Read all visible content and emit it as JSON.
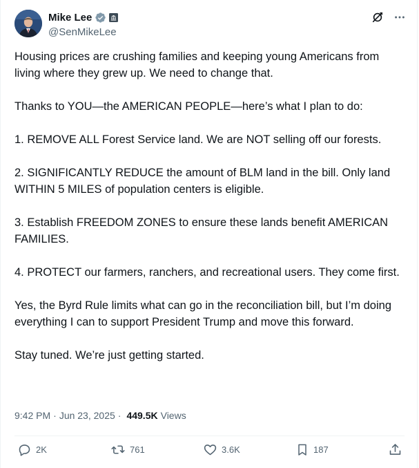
{
  "author": {
    "display_name": "Mike Lee",
    "handle": "@SenMikeLee",
    "verified_color": "#829aab"
  },
  "icons": {
    "verified": "verified-badge-icon",
    "gov": "government-badge-icon",
    "grok": "grok-icon",
    "more": "more-icon"
  },
  "tweet": {
    "paragraphs": [
      "Housing prices are crushing families and keeping young Americans from living where they grew up. We need to change that.",
      "Thanks to YOU—the AMERICAN PEOPLE—here’s what I plan to do:",
      "1. REMOVE ALL Forest Service land. We are NOT selling off our forests.",
      "2. SIGNIFICANTLY REDUCE the amount of BLM land in the bill. Only land WITHIN 5 MILES of population centers is eligible.",
      "3. Establish FREEDOM ZONES to ensure these lands benefit AMERICAN FAMILIES.",
      "4. PROTECT our farmers, ranchers, and recreational users. They come first.",
      "Yes, the Byrd Rule limits what can go in the reconciliation bill, but I’m doing everything I can to support President Trump and move this forward.",
      "Stay tuned. We’re just getting started."
    ]
  },
  "meta": {
    "time": "9:42 PM",
    "separator": "·",
    "date": "Jun 23, 2025",
    "views_count": "449.5K",
    "views_label": "Views"
  },
  "actions": {
    "replies": "2K",
    "reposts": "761",
    "likes": "3.6K",
    "bookmarks": "187"
  },
  "colors": {
    "text": "#0f1419",
    "secondary": "#536471",
    "divider": "#eff3f4"
  }
}
